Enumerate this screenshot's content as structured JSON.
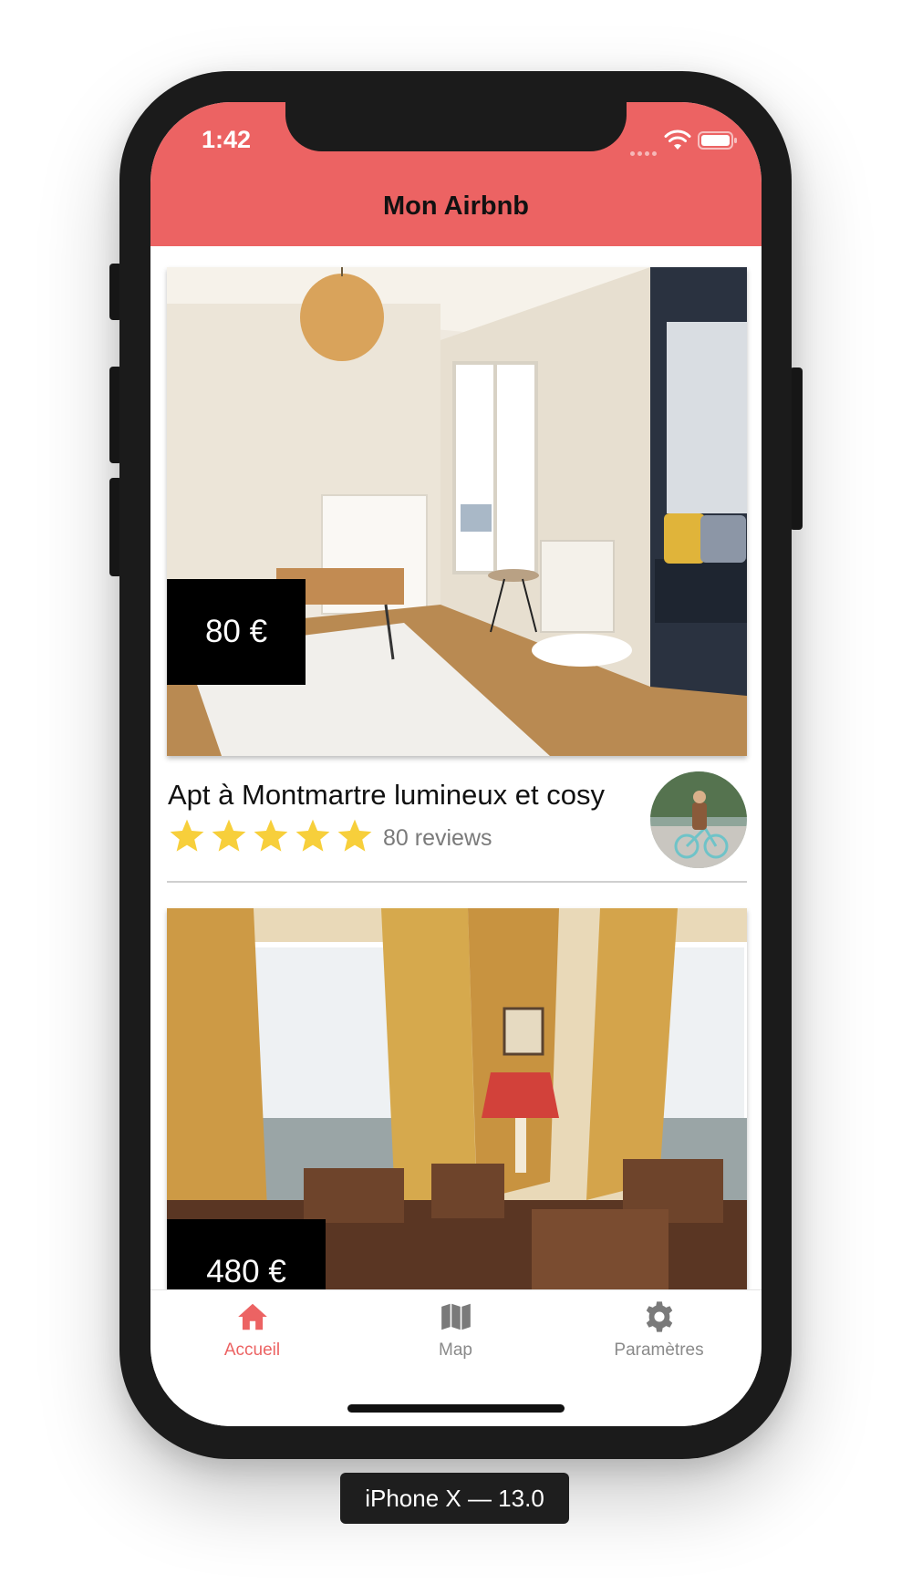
{
  "status_bar": {
    "time": "1:42"
  },
  "header": {
    "title": "Mon Airbnb"
  },
  "listings": [
    {
      "price": "80 €",
      "title": "Apt à Montmartre lumineux et cosy",
      "rating": 5,
      "reviews": "80 reviews"
    },
    {
      "price": "480 €"
    }
  ],
  "tabbar": {
    "items": [
      {
        "label": "Accueil",
        "icon": "home-icon",
        "active": true
      },
      {
        "label": "Map",
        "icon": "map-icon",
        "active": false
      },
      {
        "label": "Paramètres",
        "icon": "gear-icon",
        "active": false
      }
    ]
  },
  "device_caption": "iPhone X — 13.0",
  "colors": {
    "accent": "#ec6363",
    "star": "#f7cf3b",
    "tab_inactive": "#8a8a8a"
  }
}
